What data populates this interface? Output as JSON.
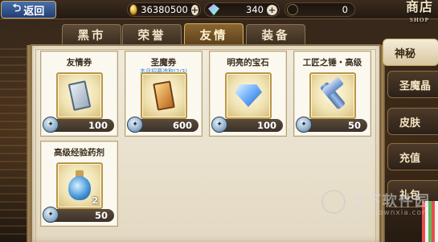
{
  "topbar": {
    "back_label": "返回",
    "gold": "36380500",
    "gems": "340",
    "third_currency": "0",
    "shop_title": "商店",
    "shop_subtitle": "SHOP"
  },
  "tabs": [
    {
      "label": "黑市",
      "active": false
    },
    {
      "label": "荣誉",
      "active": false
    },
    {
      "label": "友情",
      "active": true
    },
    {
      "label": "装备",
      "active": false
    }
  ],
  "items": [
    {
      "name": "友情券",
      "subtitle": "",
      "price": "100",
      "icon": "silver-ticket-icon"
    },
    {
      "name": "圣魔券",
      "subtitle": "本月招募选取(2/3)",
      "price": "600",
      "icon": "gold-ticket-icon"
    },
    {
      "name": "明亮的宝石",
      "subtitle": "",
      "price": "100",
      "icon": "blue-gem-icon"
    },
    {
      "name": "工匠之锤・高级",
      "subtitle": "",
      "price": "50",
      "icon": "hammer-icon"
    },
    {
      "name": "高级经验药剂",
      "subtitle": "",
      "price": "50",
      "icon": "potion-icon",
      "quantity": "2"
    }
  ],
  "side_menu": [
    {
      "label": "神秘",
      "active": true
    },
    {
      "label": "圣魔晶",
      "active": false
    },
    {
      "label": "皮肤",
      "active": false
    },
    {
      "label": "充值",
      "active": false
    },
    {
      "label": "礼包",
      "active": false
    }
  ],
  "watermark": {
    "text": "当下软件园",
    "url": "www.downxia.com"
  }
}
